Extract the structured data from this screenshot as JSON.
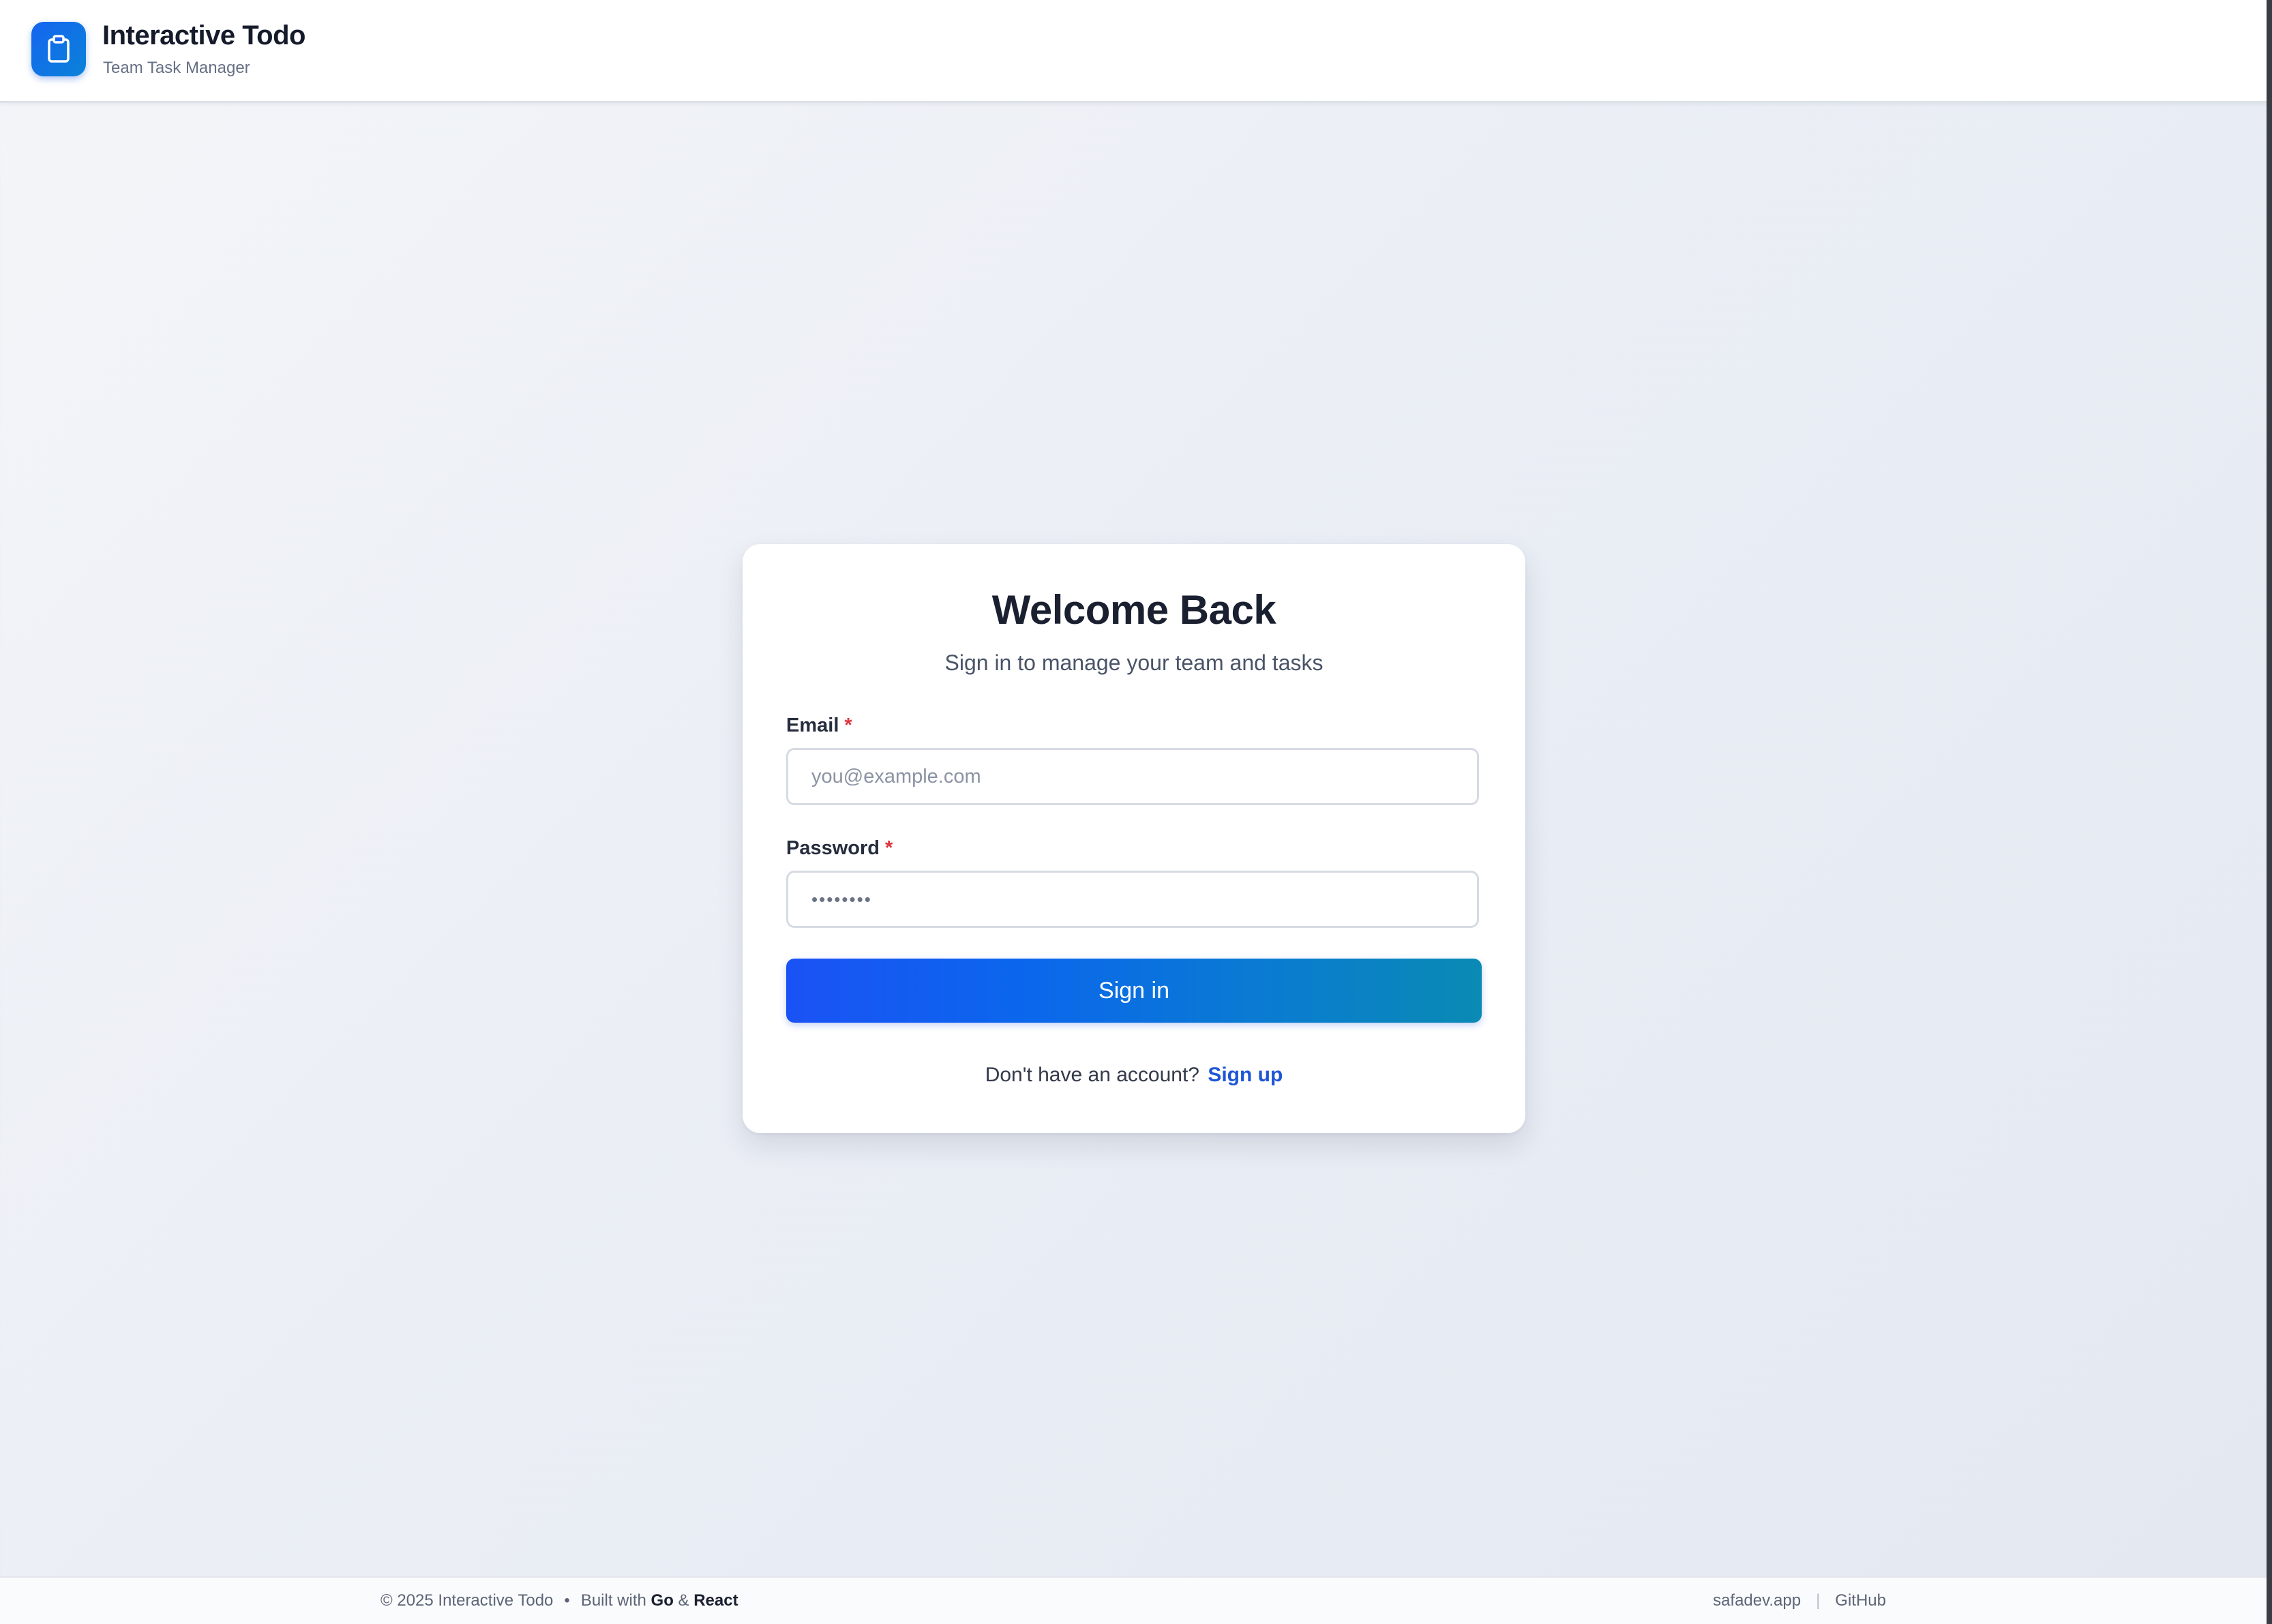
{
  "header": {
    "app_title": "Interactive Todo",
    "app_subtitle": "Team Task Manager",
    "logo_icon": "clipboard-icon"
  },
  "login": {
    "title": "Welcome Back",
    "subtitle": "Sign in to manage your team and tasks",
    "email": {
      "label": "Email",
      "required_mark": "*",
      "placeholder": "you@example.com",
      "value": ""
    },
    "password": {
      "label": "Password",
      "required_mark": "*",
      "placeholder": "••••••••",
      "value": ""
    },
    "submit_label": "Sign in",
    "signup_prompt": "Don't have an account?",
    "signup_link": "Sign up"
  },
  "footer": {
    "copyright": "© 2025 Interactive Todo",
    "separator": "•",
    "built_with_prefix": "Built with",
    "tech_1": "Go",
    "ampersand": "&",
    "tech_2": "React",
    "link_site": "safadev.app",
    "link_divider": "|",
    "link_github": "GitHub"
  },
  "colors": {
    "accent": "#1b52f5",
    "accent_end": "#0a8ab4",
    "link": "#1d55d6",
    "required": "#e0323c"
  }
}
